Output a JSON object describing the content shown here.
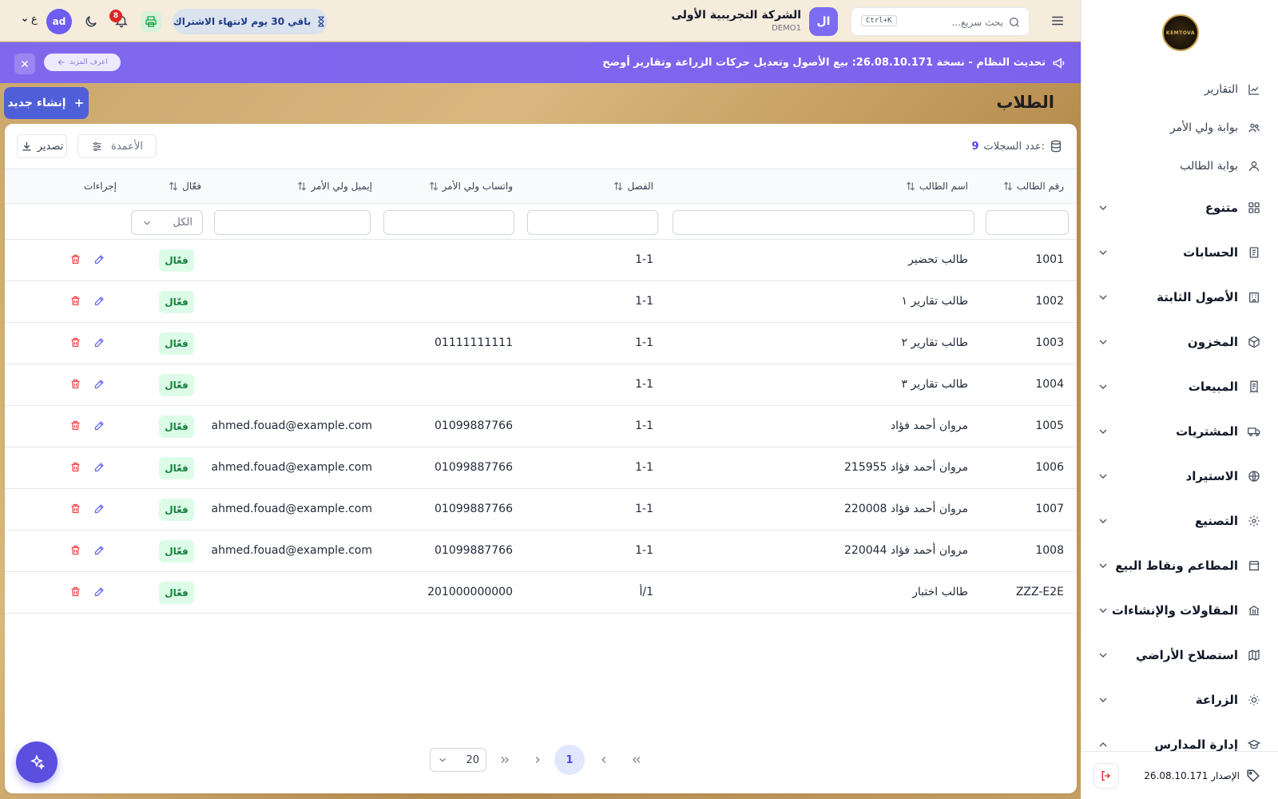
{
  "sidebar": {
    "logo_text": "KEMTOVA",
    "links": [
      {
        "label": "التقارير",
        "icon": "chart-icon"
      },
      {
        "label": "بوابة ولي الأمر",
        "icon": "users-icon"
      },
      {
        "label": "بوابة الطالب",
        "icon": "user-icon"
      }
    ],
    "groups": [
      {
        "label": "متنوع",
        "icon": "grid-icon"
      },
      {
        "label": "الحسابات",
        "icon": "receipt-icon"
      },
      {
        "label": "الأصول الثابتة",
        "icon": "building-icon"
      },
      {
        "label": "المخزون",
        "icon": "box-icon"
      },
      {
        "label": "المبيعات",
        "icon": "invoice-icon"
      },
      {
        "label": "المشتريات",
        "icon": "truck-icon"
      },
      {
        "label": "الاستيراد",
        "icon": "globe-icon"
      },
      {
        "label": "التصنيع",
        "icon": "gear-icon"
      },
      {
        "label": "المطاعم ونقاط البيع",
        "icon": "store-icon"
      },
      {
        "label": "المقاولات والإنشاءات",
        "icon": "bank-icon"
      },
      {
        "label": "استصلاح الأراضي",
        "icon": "map-icon"
      },
      {
        "label": "الزراعة",
        "icon": "sun-icon"
      },
      {
        "label": "إدارة المدارس",
        "icon": "graduation-icon"
      }
    ],
    "version_label": "الإصدار 26.08.10.171"
  },
  "topbar": {
    "search_placeholder": "بحث سريع...",
    "search_shortcut": "Ctrl+K",
    "company_initials": "ال",
    "company_name": "الشركة التجريبية الأولى",
    "company_code": "DEMO1",
    "subscription": "باقي 30 يوم لانتهاء الاشتراك",
    "notifications_count": "8",
    "user_initials": "ad",
    "language": "ع"
  },
  "announcement": {
    "message": "تحديث النظام - نسخة 26.08.10.171: بيع الأصول وتعديل حركات الزراعة وتقارير أوضح",
    "more_label": "اعرف المزيد"
  },
  "page": {
    "title": "الطلاب",
    "create_label": "إنشاء جديد",
    "records_label": "عدد السجلات:",
    "records_count": "9",
    "columns_label": "الأعمدة",
    "export_label": "تصدير",
    "filter_status_default": "الكل"
  },
  "table": {
    "headers": {
      "id": "رقم الطالب",
      "name": "اسم الطالب",
      "class": "الفصل",
      "whatsapp": "واتساب ولي الأمر",
      "email": "إيميل ولي الأمر",
      "active": "فعّال",
      "actions": "إجراءات"
    },
    "rows": [
      {
        "id": "1001",
        "name": "طالب تحضير",
        "class": "1-1",
        "whatsapp": "",
        "email": "",
        "status": "فعّال"
      },
      {
        "id": "1002",
        "name": "طالب تقارير ١",
        "class": "1-1",
        "whatsapp": "",
        "email": "",
        "status": "فعّال"
      },
      {
        "id": "1003",
        "name": "طالب تقارير ٢",
        "class": "1-1",
        "whatsapp": "01111111111",
        "email": "",
        "status": "فعّال"
      },
      {
        "id": "1004",
        "name": "طالب تقارير ٣",
        "class": "1-1",
        "whatsapp": "",
        "email": "",
        "status": "فعّال"
      },
      {
        "id": "1005",
        "name": "مروان أحمد فؤاد",
        "class": "1-1",
        "whatsapp": "01099887766",
        "email": "ahmed.fouad@example.com",
        "status": "فعّال"
      },
      {
        "id": "1006",
        "name": "مروان أحمد فؤاد 215955",
        "class": "1-1",
        "whatsapp": "01099887766",
        "email": "ahmed.fouad@example.com",
        "status": "فعّال"
      },
      {
        "id": "1007",
        "name": "مروان أحمد فؤاد 220008",
        "class": "1-1",
        "whatsapp": "01099887766",
        "email": "ahmed.fouad@example.com",
        "status": "فعّال"
      },
      {
        "id": "1008",
        "name": "مروان أحمد فؤاد 220044",
        "class": "1-1",
        "whatsapp": "01099887766",
        "email": "ahmed.fouad@example.com",
        "status": "فعّال"
      },
      {
        "id": "ZZZ-E2E",
        "name": "طالب اختبار",
        "class": "1/أ",
        "whatsapp": "201000000000",
        "email": "",
        "status": "فعّال"
      }
    ]
  },
  "pagination": {
    "current_page": "1",
    "page_size": "20"
  },
  "colors": {
    "primary": "#4f5fd8",
    "announcement": "#7b63ec",
    "active_badge_bg": "#dcfce7",
    "active_badge_text": "#15803d",
    "delete": "#ef4444"
  }
}
